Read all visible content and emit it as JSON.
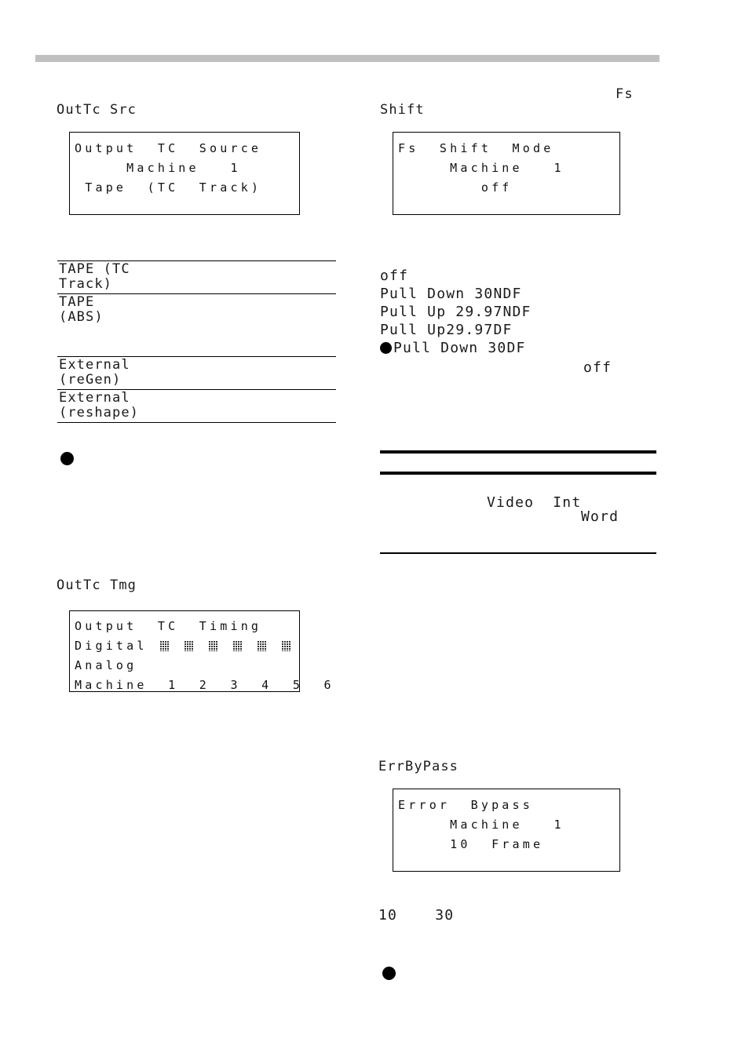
{
  "page": {
    "header_bar_color": "#c0c0c0",
    "text_color": "#1a1a1a"
  },
  "left_column": {
    "outtc_src": {
      "caption": "OutTc Src",
      "lcd": {
        "line1": "Output  TC  Source",
        "line2": "     Machine   1",
        "line3": "",
        "line4": " Tape  (TC  Track)"
      },
      "options": [
        {
          "text": "TAPE (TC\nTrack)"
        },
        {
          "text": "TAPE\n(ABS)"
        },
        {
          "text": "External\n(reGen)"
        },
        {
          "text": "External\n(reshape)"
        }
      ],
      "selected_marker": "filled-circle"
    },
    "outtc_tmg": {
      "caption": "OutTc Tmg",
      "lcd": {
        "line1": "Output  TC  Timing",
        "line2_label": "Digital",
        "line2_blocks": 6,
        "line3": "Analog",
        "line4": "Machine  1  2  3  4  5  6"
      }
    }
  },
  "right_column": {
    "fs_shift": {
      "caption_top": "Fs",
      "caption": "Shift",
      "lcd": {
        "line1": "Fs  Shift  Mode",
        "line2": "     Machine   1",
        "line3": "",
        "line4": "        off"
      },
      "options": [
        "off",
        "Pull Down 30NDF",
        "Pull Up 29.97NDF",
        "Pull Up29.97DF",
        "Pull Down 30DF"
      ],
      "selected_index": 4,
      "default_value": "off"
    },
    "clock_rules": {
      "value_line1": "Video  Int",
      "value_line2": "Word"
    },
    "err_bypass": {
      "caption": "ErrByPass",
      "lcd": {
        "line1": "Error  Bypass",
        "line2": "     Machine   1",
        "line3": "",
        "line4": "     10  Frame"
      },
      "range_text": "10    30",
      "selected_marker": "filled-circle"
    }
  }
}
